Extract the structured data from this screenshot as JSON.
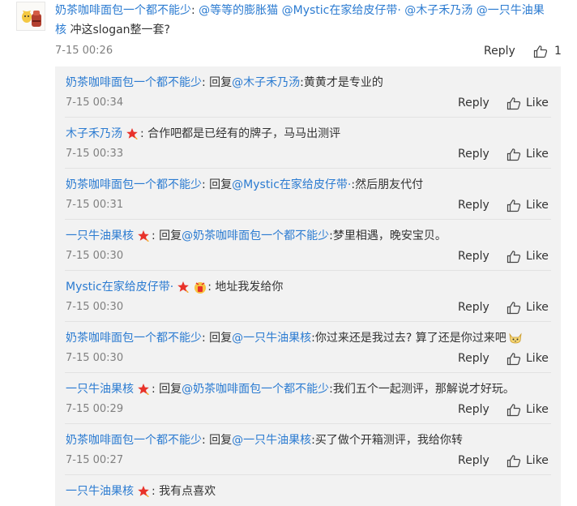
{
  "top_comment": {
    "author": "奶茶咖啡面包一个都不能少",
    "mentions": "@等等的膨胀猫 @Mystic在家给皮仔带· @木子禾乃汤 @一只牛油果",
    "mention_cont": "核",
    "text": "冲这slogan整一套?",
    "time": "7-15 00:26",
    "reply_label": "Reply",
    "like_count": "1"
  },
  "replies": [
    {
      "author": "奶茶咖啡面包一个都不能少",
      "badge": false,
      "prefix": "回复",
      "mention": "@木子禾乃汤",
      "text": ":黄黄才是专业的",
      "time": "7-15 00:34"
    },
    {
      "author": "木子禾乃汤",
      "badge": true,
      "prefix": "",
      "mention": "",
      "text": "合作吧都是已经有的牌子，马马出测评",
      "time": "7-15 00:33"
    },
    {
      "author": "奶茶咖啡面包一个都不能少",
      "badge": false,
      "prefix": "回复",
      "mention": "@Mystic在家给皮仔带·",
      "text": ":然后朋友代付",
      "time": "7-15 00:31"
    },
    {
      "author": "一只牛油果核",
      "badge": true,
      "prefix": "回复",
      "mention": "@奶茶咖啡面包一个都不能少",
      "text": ":梦里相遇，晚安宝贝。",
      "time": "7-15 00:30"
    },
    {
      "author": "Mystic在家给皮仔带·",
      "badge": true,
      "prefix": "",
      "mention": "",
      "text": "地址我发给你",
      "time": "7-15 00:30"
    },
    {
      "author": "奶茶咖啡面包一个都不能少",
      "badge": false,
      "prefix": "回复",
      "mention": "@一只牛油果核",
      "text": ":你过来还是我过去? 算了还是你过来吧",
      "time": "7-15 00:30"
    },
    {
      "author": "一只牛油果核",
      "badge": true,
      "prefix": "回复",
      "mention": "@奶茶咖啡面包一个都不能少",
      "text": ":我们五个一起测评，那解说才好玩。",
      "time": "7-15 00:29"
    },
    {
      "author": "奶茶咖啡面包一个都不能少",
      "badge": false,
      "prefix": "回复",
      "mention": "@一只牛油果核",
      "text": ":买了做个开箱测评，我给你转",
      "time": "7-15 00:27"
    },
    {
      "author": "一只牛油果核",
      "badge": true,
      "prefix": "",
      "mention": "",
      "text": "我有点喜欢",
      "time": ""
    }
  ],
  "labels": {
    "reply": "Reply",
    "like": "Like",
    "colon": ":"
  },
  "colors": {
    "link": "#2b7bd1",
    "panel": "#f2f2f2",
    "badge": "#e8322a"
  },
  "icons": {
    "badge": "star-badge-icon",
    "like": "thumbs-up-icon",
    "emoji": "cat-emoji-icon",
    "fan": "fan-emoji-icon"
  }
}
